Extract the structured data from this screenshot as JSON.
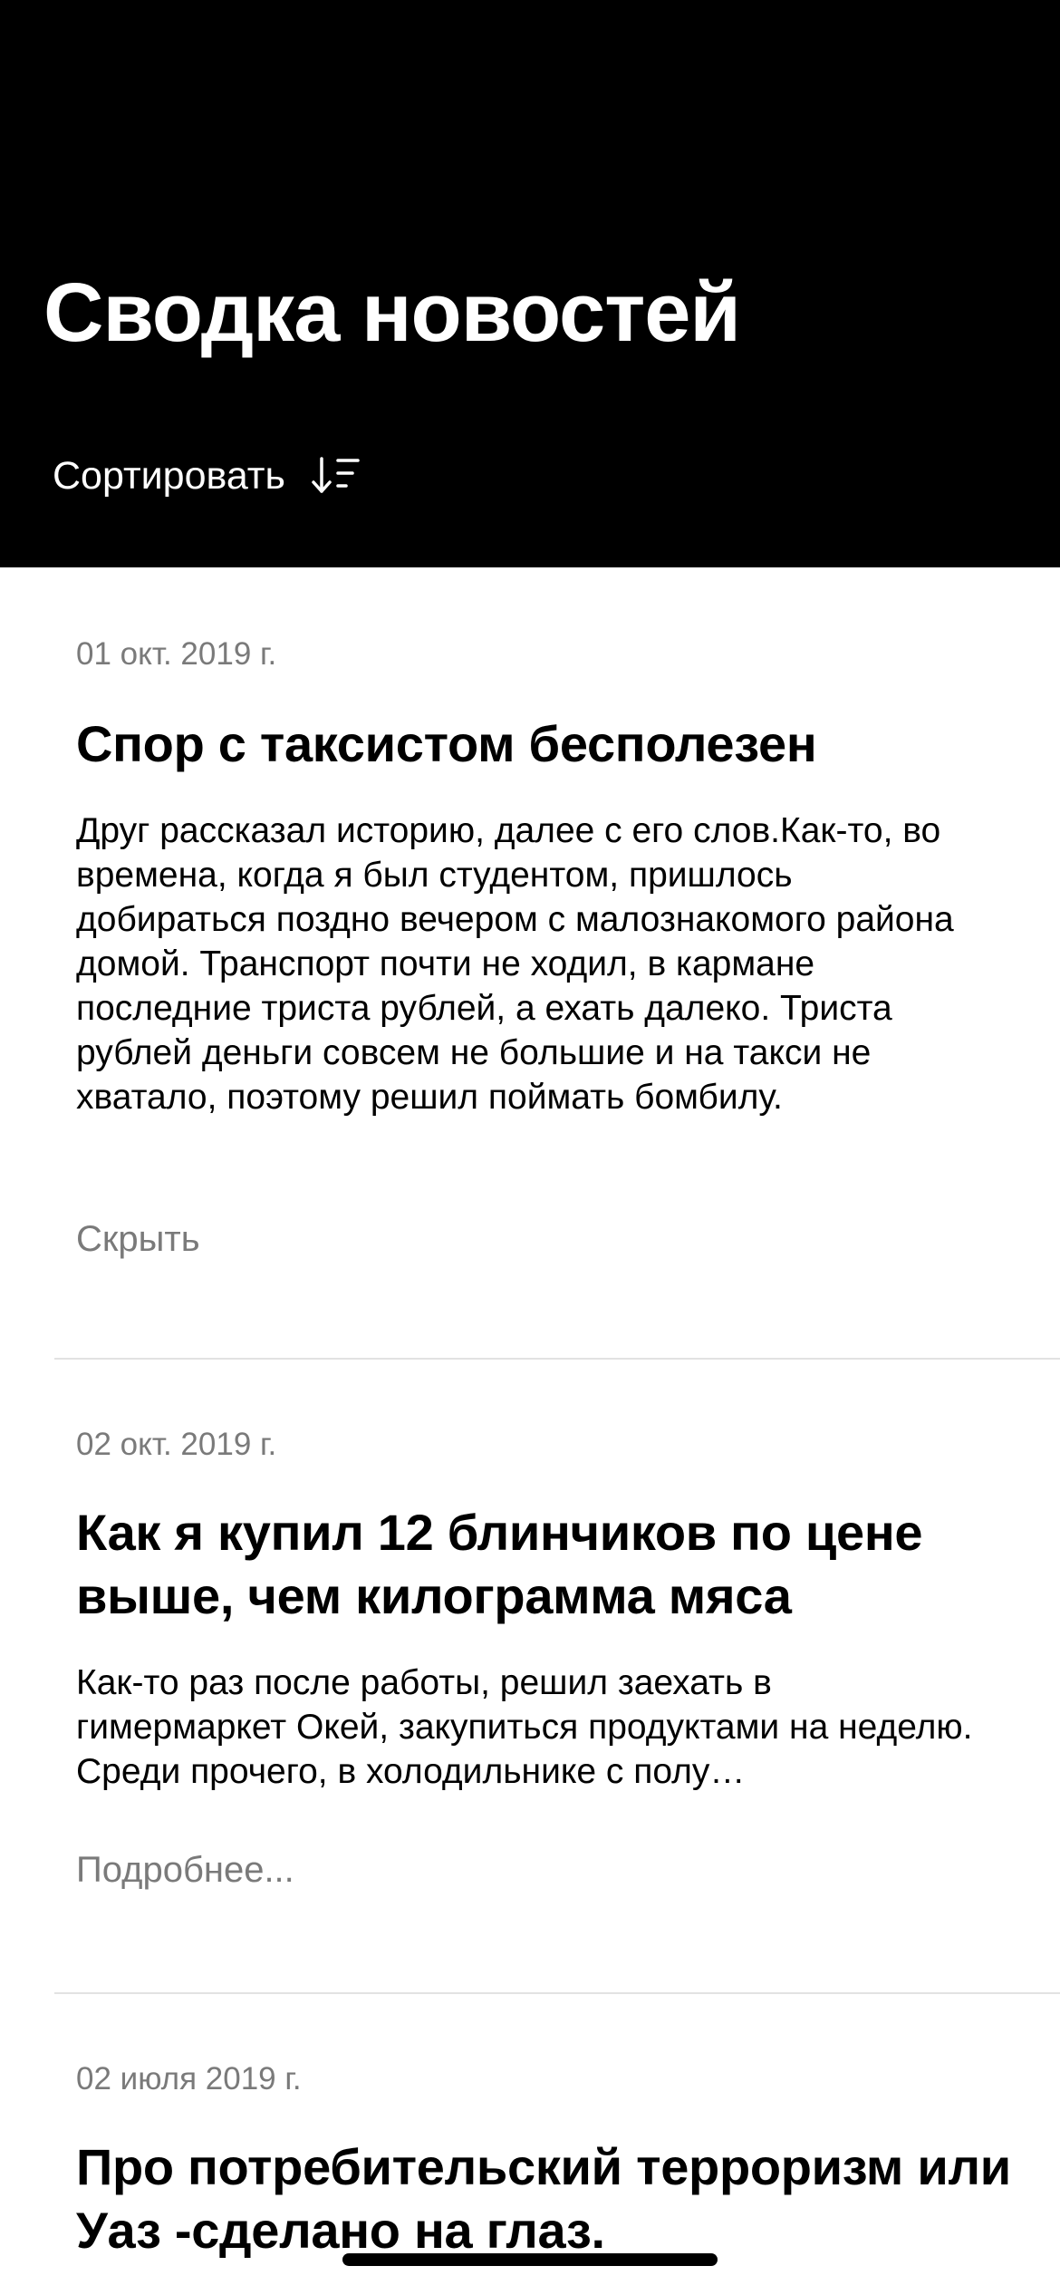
{
  "header": {
    "title": "Сводка новостей",
    "sort_label": "Сортировать",
    "sort_icon": "sort-descending-icon",
    "background": "#000000",
    "text_color": "#ffffff"
  },
  "articles": [
    {
      "date": "01 окт. 2019 г.",
      "title": "Спор с таксистом бесполезен",
      "body": "Друг рассказал историю, далее с его слов.Как-то, во времена, когда я был студентом, пришлось добираться поздно вечером с малознакомого района домой. Транспорт почти не ходил, в кармане последние триста рублей, а ехать далеко. Триста рублей деньги совсем не большие и на такси не хватало, поэтому решил поймать бомбилу.",
      "action": "Скрыть",
      "expanded": true
    },
    {
      "date": "02 окт. 2019 г.",
      "title": "Как я купил 12 блинчиков по цене выше, чем килограмма мяса",
      "body": "Как-то раз после работы, решил заехать в гимермаркет Окей, закупиться продуктами на неделю. Среди прочего, в холодильнике с полу…",
      "action": "Подробнее...",
      "expanded": false
    },
    {
      "date": "02 июля 2019 г.",
      "title": "Про потребительский терроризм или Уаз -сделано на глаз."
    }
  ],
  "colors": {
    "secondary_text": "#7a7a7a",
    "divider": "#e2e2e2"
  }
}
